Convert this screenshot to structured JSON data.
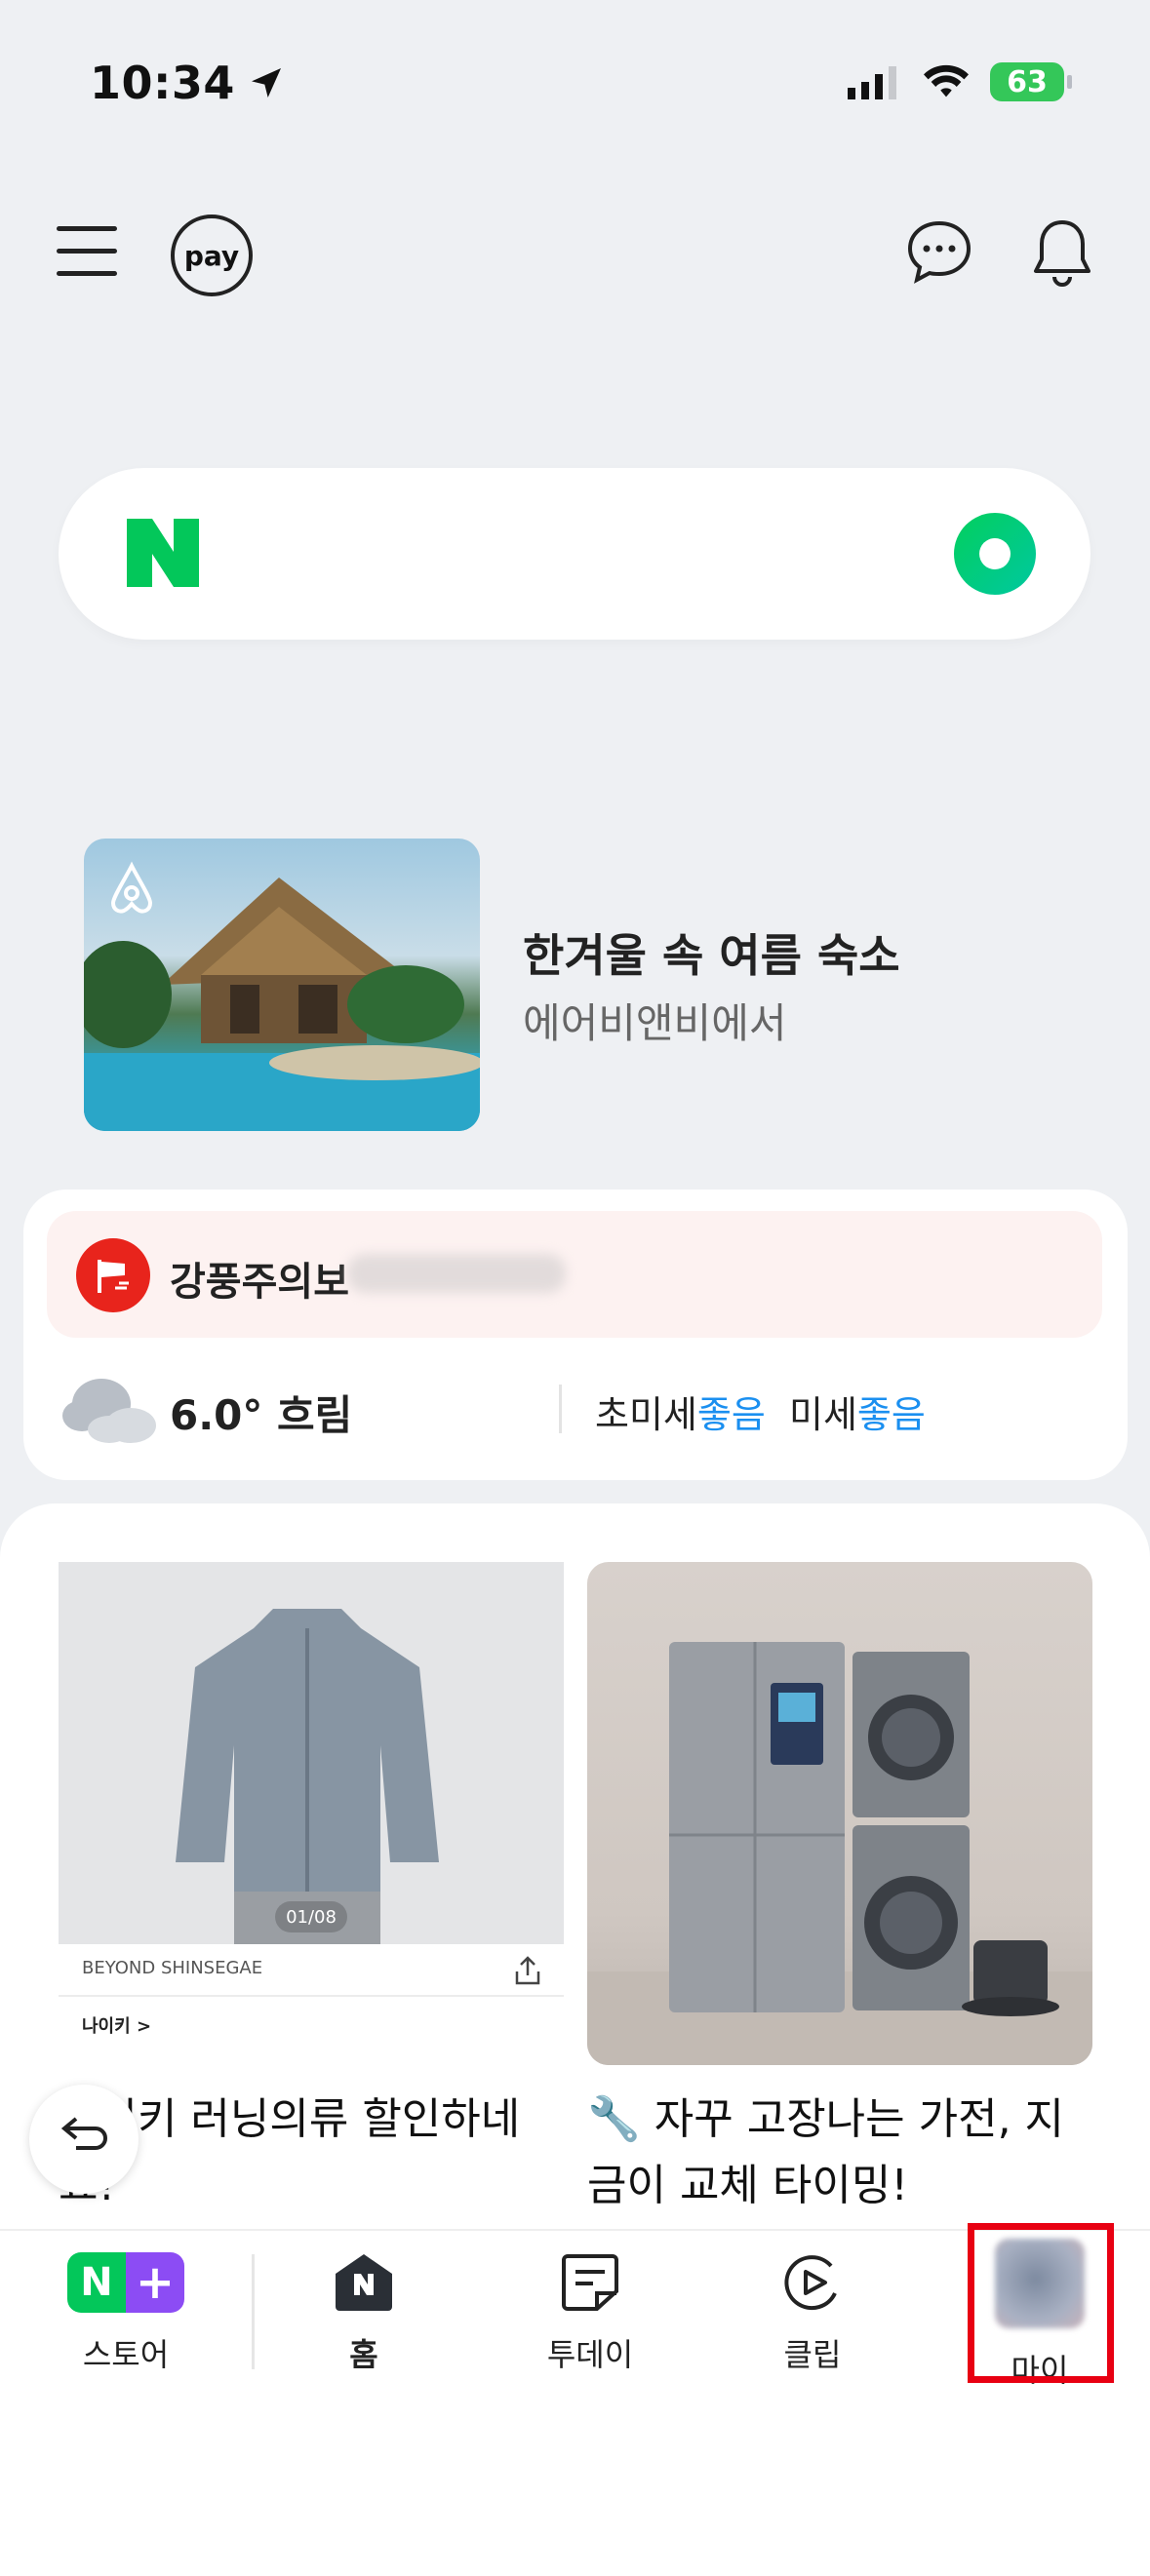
{
  "status_bar": {
    "time": "10:34",
    "battery": "63"
  },
  "header": {
    "pay_label": "pay"
  },
  "search": {
    "logo": "N"
  },
  "ad": {
    "title": "한겨울 속 여름 숙소",
    "subtitle": "에어비앤비에서"
  },
  "weather": {
    "alert": "강풍주의보",
    "temperature": "6.0° 흐림",
    "ultrafine_label": "초미세",
    "ultrafine_value": "좋음",
    "fine_label": "미세",
    "fine_value": "좋음"
  },
  "feed": {
    "left": {
      "page_indicator": "01/08",
      "brand": "BEYOND SHINSEGAE",
      "shop": "나이키 >",
      "caption": "나이키 러닝의류 할인하네요!"
    },
    "right": {
      "caption": "🔧 자꾸 고장나는 가전, 지금이 교체 타이밍!"
    }
  },
  "bottom_nav": {
    "items": [
      {
        "label": "스토어"
      },
      {
        "label": "홈"
      },
      {
        "label": "투데이"
      },
      {
        "label": "클립"
      },
      {
        "label": "마이"
      }
    ]
  },
  "colors": {
    "naver_green": "#03c75a",
    "highlight": "#e80012",
    "good": "#1a8ff0"
  }
}
